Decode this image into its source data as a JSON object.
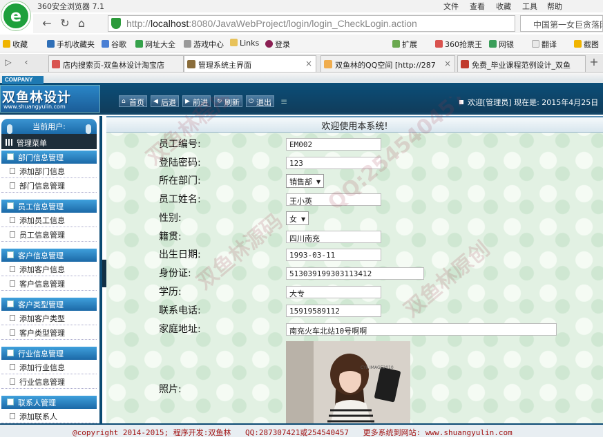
{
  "browser": {
    "title": "360安全浏览器 7.1",
    "menu": [
      "文件",
      "查看",
      "收藏",
      "工具",
      "帮助"
    ],
    "url_prefix": "http://",
    "url_host": "localhost",
    "url_rest": ":8080/JavaWebProject/login/login_CheckLogin.action",
    "search_placeholder": "中国第一女巨贪落网",
    "bookmarks": [
      "收藏",
      "手机收藏夹",
      "谷歌",
      "网址大全",
      "游戏中心",
      "Links",
      "登录",
      "扩展",
      "360抢票王",
      "网银",
      "翻译",
      "截图"
    ],
    "tabs": [
      {
        "label": "店内搜索页-双鱼林设计淘宝店",
        "active": false,
        "color": "#d9534f"
      },
      {
        "label": "管理系统主界面",
        "active": true,
        "color": "#8a6d3b"
      },
      {
        "label": "双鱼林的QQ空间 [http://287",
        "active": false,
        "color": "#f0ad4e"
      },
      {
        "label": "免费_毕业课程范例设计_双鱼",
        "active": false,
        "color": "#c0392b"
      }
    ]
  },
  "header": {
    "company": "COMPANY",
    "brand": "双鱼林设计",
    "brand_url": "www.shuangyulin.com",
    "toolbar": [
      "首页",
      "后退",
      "前进",
      "刷新",
      "退出"
    ],
    "welcome": "欢迎[管理员]  现在是: 2015年4月25日"
  },
  "sidebar": {
    "current_user_label": "当前用户:",
    "admin_menu": "管理菜单",
    "groups": [
      {
        "title": "部门信息管理",
        "items": [
          "添加部门信息",
          "部门信息管理"
        ]
      },
      {
        "title": "员工信息管理",
        "items": [
          "添加员工信息",
          "员工信息管理"
        ]
      },
      {
        "title": "客户信息管理",
        "items": [
          "添加客户信息",
          "客户信息管理"
        ]
      },
      {
        "title": "客户类型管理",
        "items": [
          "添加客户类型",
          "客户类型管理"
        ]
      },
      {
        "title": "行业信息管理",
        "items": [
          "添加行业信息",
          "行业信息管理"
        ]
      },
      {
        "title": "联系人管理",
        "items": [
          "添加联系人"
        ]
      }
    ]
  },
  "main": {
    "heading": "欢迎使用本系统!",
    "fields": [
      {
        "label": "员工编号:",
        "value": "EM002"
      },
      {
        "label": "登陆密码:",
        "value": "123"
      },
      {
        "label": "所在部门:",
        "value": "销售部"
      },
      {
        "label": "员工姓名:",
        "value": "王小英"
      },
      {
        "label": "性别:",
        "value": "女"
      },
      {
        "label": "籍贯:",
        "value": "四川南充"
      },
      {
        "label": "出生日期:",
        "value": "1993-03-11"
      },
      {
        "label": "身份证:",
        "value": "513039199303113412"
      },
      {
        "label": "学历:",
        "value": "大专"
      },
      {
        "label": "联系电话:",
        "value": "15919589112"
      },
      {
        "label": "家庭地址:",
        "value": "南充火车北站10号啊啊"
      },
      {
        "label": "照片:",
        "value": ""
      }
    ],
    "photo_caption": "CYL IMAGE2010"
  },
  "footer": {
    "copyright": "@copyright 2014-2015;",
    "developer": "程序开发:双鱼林",
    "qq": "QQ:287307421或254540457",
    "more": "更多系统到网站: www.shuangyulin.com"
  },
  "watermark": [
    "双鱼林程序设计",
    "QQ:254540457",
    "双鱼林源码",
    "双鱼林原创"
  ]
}
